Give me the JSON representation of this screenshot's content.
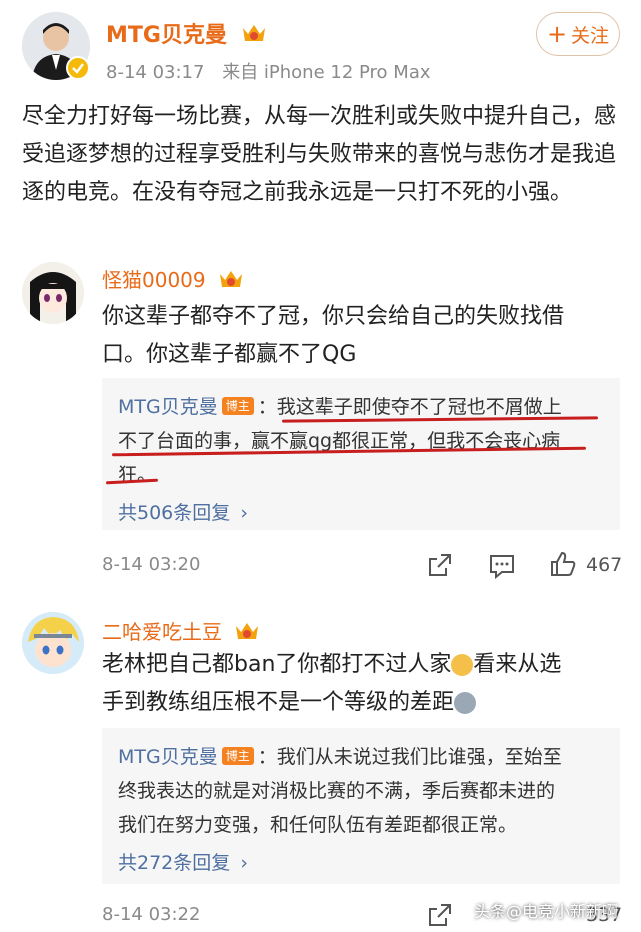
{
  "post": {
    "author": "MTG贝克曼",
    "time": "8-14 03:17",
    "source": "来自 iPhone 12 Pro Max",
    "follow_label": "关注",
    "content": "尽全力打好每一场比赛，从每一次胜利或失败中提升自己，感受追逐梦想的过程享受胜利与失败带来的喜悦与悲伤才是我追逐的电竞。在没有夺冠之前我永远是一只打不死的小强。"
  },
  "comments": [
    {
      "name": "怪猫00009",
      "text_line1": "你这辈子都夺不了冠，你只会给自己的失败找借",
      "text_line2": "口。你这辈子都赢不了QG",
      "reply": {
        "author": "MTG贝克曼",
        "badge": "博主",
        "line1": "：我这辈子即使夺不了冠也不屑做上",
        "line2": "不了台面的事，赢不赢qg都很正常，但我不会丧心病",
        "line3": "狂。",
        "count": "共506条回复"
      },
      "time": "8-14 03:20",
      "likes": "467"
    },
    {
      "name": "二哈爱吃土豆",
      "text_line1": "老林把自己都ban了你都打不过人家",
      "text_line1b": "看来从选",
      "text_line2": "手到教练组压根不是一个等级的差距",
      "reply": {
        "author": "MTG贝克曼",
        "badge": "博主",
        "line1": "：我们从未说过我们比谁强，至始至",
        "line2": "终我表达的就是对消极比赛的不满，季后赛都未进的",
        "line3": "我们在努力变强，和任何队伍有差距都很正常。",
        "count": "共272条回复"
      },
      "time": "8-14 03:22",
      "likes": "337"
    }
  ],
  "watermark": "头条@电竞小新新啊",
  "colors": {
    "name": "#e86b1a",
    "link": "#4e6fa0",
    "underline": "#c81e1e",
    "badge": "#f58220"
  }
}
